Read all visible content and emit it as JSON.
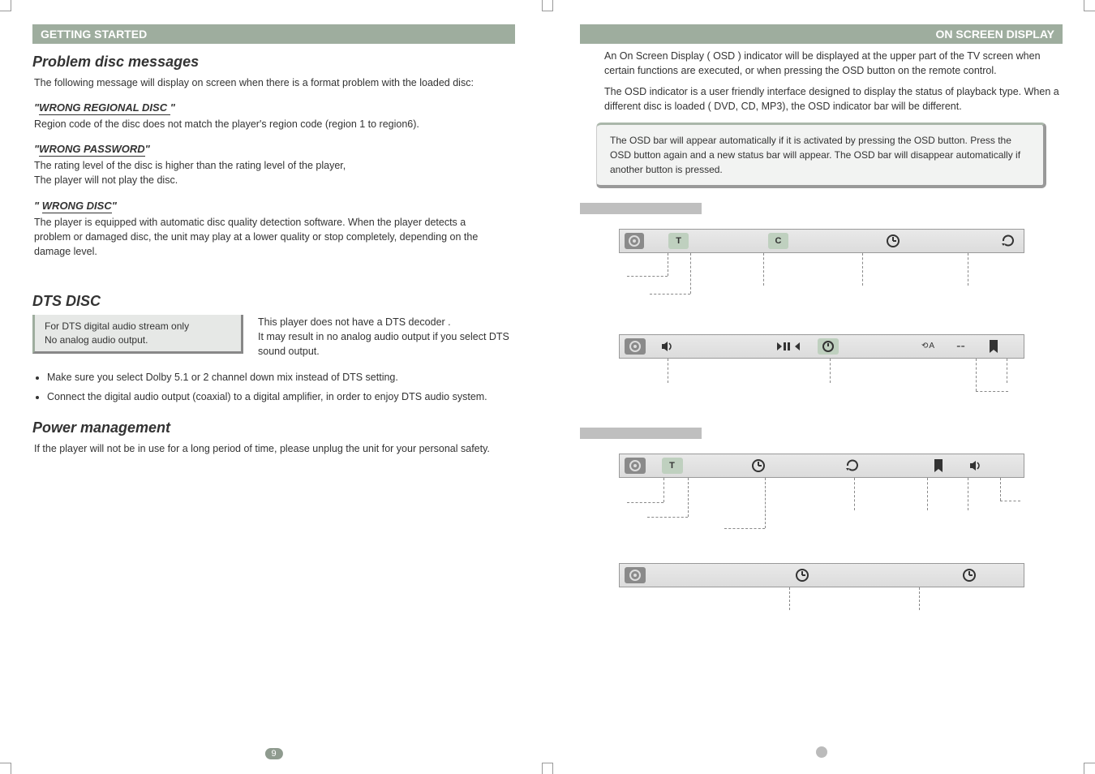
{
  "left": {
    "section_heading": "GETTING STARTED",
    "h2_problem": "Problem disc messages",
    "intro": "The following message will display on screen when there is a format problem with the loaded disc:",
    "msg1_title": "WRONG REGIONAL DISC ",
    "msg1_body": "Region code of the disc does not match the player's region code (region 1 to region6).",
    "msg2_title": "WRONG PASSWORD",
    "msg2_body_l1": "The rating level of the disc is higher than the rating level of the player,",
    "msg2_body_l2": "The player will not play the disc.",
    "msg3_title": "WRONG DISC",
    "msg3_body": "The player is equipped with automatic disc quality detection software. When the player detects a problem or damaged disc, the unit may play at a lower quality or stop completely, depending on the damage level.",
    "h2_dts": "DTS DISC",
    "dts_box_l1": "For DTS digital audio stream only",
    "dts_box_l2": "No analog audio output.",
    "dts_side_l1": "This player does not have a DTS decoder       .",
    "dts_side_l2": "It may result in no analog audio output if you select DTS sound output.",
    "bullet1": "Make sure you select Dolby 5.1 or 2 channel down mix instead of DTS setting.",
    "bullet2": "Connect the digital audio output (coaxial) to a digital amplifier, in order to enjoy DTS audio system.",
    "h2_power": "Power management",
    "power_body": "If the player will not be in use for a long period of time, please unplug the unit for your personal safety.",
    "page_num": "9"
  },
  "right": {
    "section_heading": "ON SCREEN DISPLAY",
    "para1": "An On Screen Display ( OSD ) indicator will be displayed at the upper part of the TV screen when certain functions are executed, or when pressing the OSD button on the remote control.",
    "para2": "The OSD indicator is a user friendly interface designed to display the status of playback type. When a different disc is loaded ( DVD, CD, MP3),  the OSD indicator bar will be different.",
    "note": "The OSD bar will appear automatically if it is activated by pressing the OSD button. Press the OSD button again and a new status bar will appear. The OSD bar will disappear automatically if another button is  pressed.",
    "bar1_icons": [
      "disc",
      "T",
      "C",
      "clock",
      "repeat"
    ],
    "bar2_icons": [
      "disc",
      "sound",
      "playctl",
      "clock",
      "ab",
      "marker"
    ],
    "bar3_icons": [
      "disc",
      "T",
      "clock",
      "repeat",
      "marker",
      "sound"
    ],
    "bar4_icons": [
      "disc",
      "clock",
      "clock2"
    ]
  }
}
